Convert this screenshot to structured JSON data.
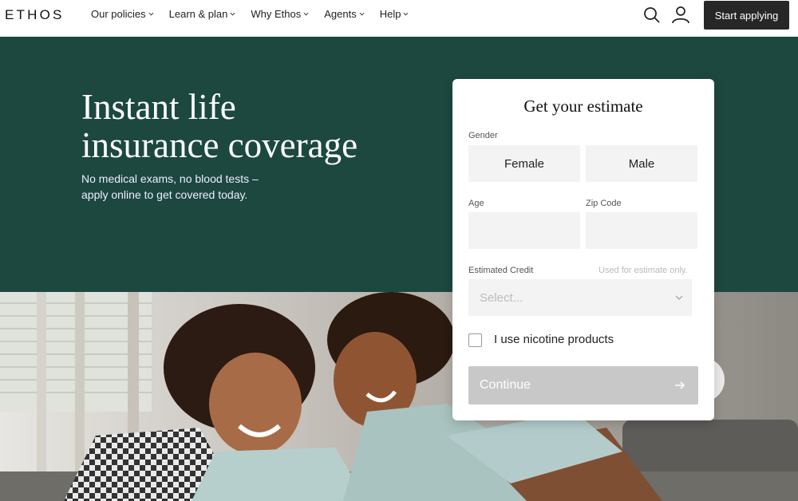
{
  "nav": {
    "logo": "ETHOS",
    "links": [
      {
        "label": "Our policies"
      },
      {
        "label": "Learn & plan"
      },
      {
        "label": "Why Ethos"
      },
      {
        "label": "Agents"
      },
      {
        "label": "Help"
      }
    ],
    "cta_label": "Start applying",
    "icons": [
      "search-icon",
      "user-icon",
      "chevron-down-icon"
    ]
  },
  "hero": {
    "title_line1": "Instant life",
    "title_line2": "insurance coverage",
    "subtitle_line1": "No medical exams, no blood tests –",
    "subtitle_line2": "apply online to get covered today."
  },
  "estimate": {
    "title": "Get your estimate",
    "gender_label": "Gender",
    "gender_options": [
      "Female",
      "Male"
    ],
    "age_label": "Age",
    "zip_label": "Zip Code",
    "credit_label": "Estimated Credit",
    "credit_hint": "Used for estimate only.",
    "credit_placeholder": "Select...",
    "nicotine_label": "I use nicotine products",
    "nicotine_checked": false,
    "continue_label": "Continue"
  },
  "colors": {
    "hero_bg": "#1c4840",
    "cta_bg": "#272727",
    "continue_bg": "#c8c8c8",
    "field_bg": "#f3f3f3"
  }
}
